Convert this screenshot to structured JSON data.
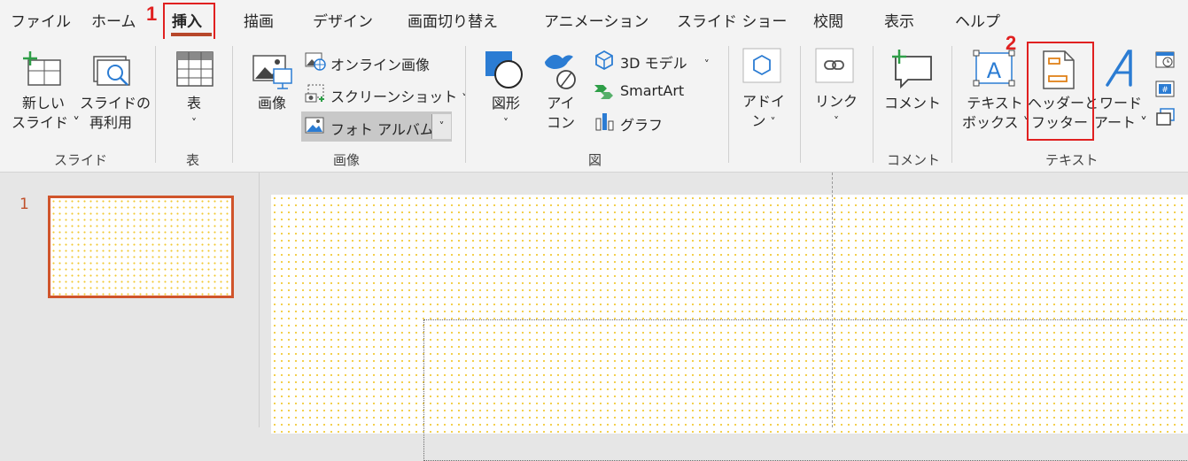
{
  "tabs": [
    "ファイル",
    "ホーム",
    "挿入",
    "描画",
    "デザイン",
    "画面切り替え",
    "アニメーション",
    "スライド ショー",
    "校閲",
    "表示",
    "ヘルプ"
  ],
  "callouts": {
    "one": "1",
    "two": "2"
  },
  "groups": {
    "slides": {
      "label": "スライド",
      "new_slide": [
        "新しい",
        "スライド"
      ],
      "reuse": [
        "スライドの",
        "再利用"
      ]
    },
    "table": {
      "label": "表",
      "table_btn": "表"
    },
    "images": {
      "label": "画像",
      "image_btn": "画像",
      "online": "オンライン画像",
      "screenshot": "スクリーンショット",
      "photo_album": "フォト アルバム"
    },
    "illustrations": {
      "label": "図",
      "shapes": "図形",
      "icons": [
        "アイ",
        "コン"
      ],
      "models3d": "3D モデル",
      "smartart": "SmartArt",
      "chart": "グラフ"
    },
    "addins": {
      "label": [
        "アドイ",
        "ン"
      ]
    },
    "links": {
      "label": "リンク"
    },
    "comments": {
      "label": "コメント",
      "comment_btn": "コメント"
    },
    "text": {
      "label": "テキスト",
      "textbox": [
        "テキスト",
        "ボックス"
      ],
      "header_footer": [
        "ヘッダーと",
        "フッター"
      ],
      "wordart": [
        "ワード",
        "アート"
      ]
    }
  },
  "slides": {
    "current_number": "1"
  },
  "colors": {
    "accent": "#b7472a",
    "callout": "#e02020",
    "dots": "#f1c832"
  }
}
